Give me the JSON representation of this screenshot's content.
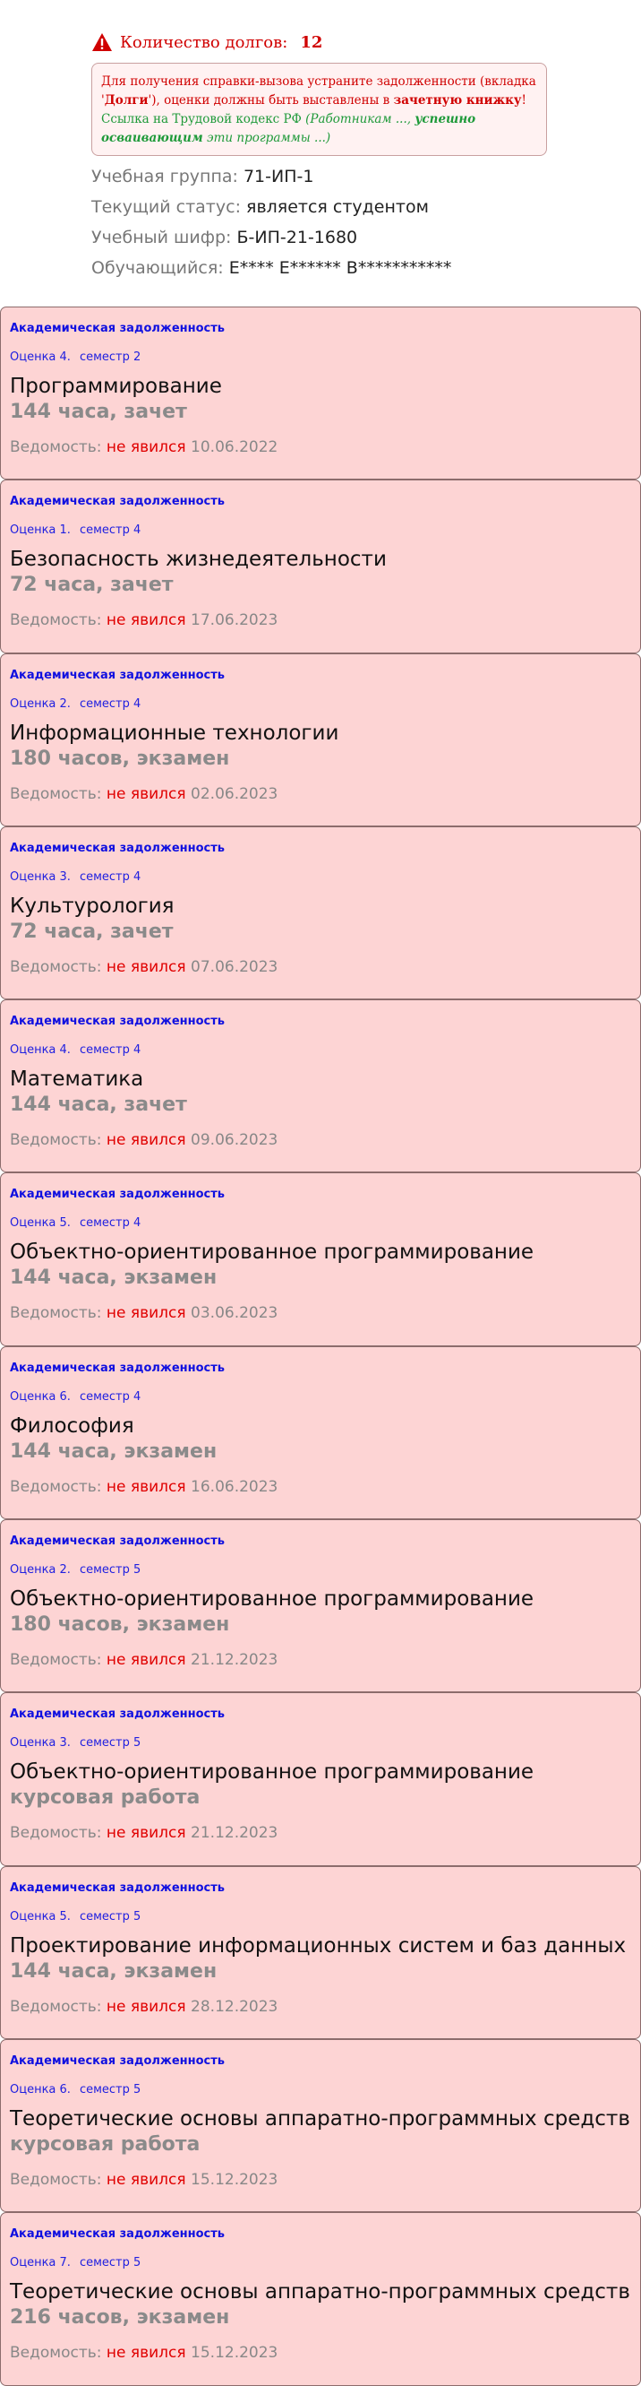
{
  "header": {
    "debt_label": "Количество долгов:",
    "debt_count": "12"
  },
  "notice": {
    "line1a": "Для получения справки-вызова устраните задолженности (вкладка '",
    "line1b": "Долги",
    "line1c": "'), оценки должны быть выставлены в ",
    "line1d": "зачетную книжку",
    "line1e": "!",
    "link_text": "Ссылка на Трудовой кодекс РФ",
    "link_paren_a": "(Работникам ..., ",
    "link_paren_b": "успешно осваивающим",
    "link_paren_c": " эти программы ...)"
  },
  "student": {
    "group_label": "Учебная группа:",
    "group_value": "71-ИП-1",
    "status_label": "Текущий статус:",
    "status_value": "является студентом",
    "cipher_label": "Учебный шифр:",
    "cipher_value": "Б-ИП-21-1680",
    "student_label": "Обучающийся:",
    "student_value": "Е**** Е****** В***********"
  },
  "debts": [
    {
      "kind": "Академическая задолженность",
      "grade": "Оценка 4.",
      "semester": "семестр 2",
      "title": "Программирование",
      "hours": "144 часа, зачет",
      "vedom_label": "Ведомость:",
      "status": "не явился",
      "date": "10.06.2022"
    },
    {
      "kind": "Академическая задолженность",
      "grade": "Оценка 1.",
      "semester": "семестр 4",
      "title": "Безопасность жизнедеятельности",
      "hours": "72 часа, зачет",
      "vedom_label": "Ведомость:",
      "status": "не явился",
      "date": "17.06.2023"
    },
    {
      "kind": "Академическая задолженность",
      "grade": "Оценка 2.",
      "semester": "семестр 4",
      "title": "Информационные технологии",
      "hours": "180 часов, экзамен",
      "vedom_label": "Ведомость:",
      "status": "не явился",
      "date": "02.06.2023"
    },
    {
      "kind": "Академическая задолженность",
      "grade": "Оценка 3.",
      "semester": "семестр 4",
      "title": "Культурология",
      "hours": "72 часа, зачет",
      "vedom_label": "Ведомость:",
      "status": "не явился",
      "date": "07.06.2023"
    },
    {
      "kind": "Академическая задолженность",
      "grade": "Оценка 4.",
      "semester": "семестр 4",
      "title": "Математика",
      "hours": "144 часа, зачет",
      "vedom_label": "Ведомость:",
      "status": "не явился",
      "date": "09.06.2023"
    },
    {
      "kind": "Академическая задолженность",
      "grade": "Оценка 5.",
      "semester": "семестр 4",
      "title": "Объектно-ориентированное программирование",
      "hours": "144 часа, экзамен",
      "vedom_label": "Ведомость:",
      "status": "не явился",
      "date": "03.06.2023"
    },
    {
      "kind": "Академическая задолженность",
      "grade": "Оценка 6.",
      "semester": "семестр 4",
      "title": "Философия",
      "hours": "144 часа, экзамен",
      "vedom_label": "Ведомость:",
      "status": "не явился",
      "date": "16.06.2023"
    },
    {
      "kind": "Академическая задолженность",
      "grade": "Оценка 2.",
      "semester": "семестр 5",
      "title": "Объектно-ориентированное программирование",
      "hours": "180 часов, экзамен",
      "vedom_label": "Ведомость:",
      "status": "не явился",
      "date": "21.12.2023"
    },
    {
      "kind": "Академическая задолженность",
      "grade": "Оценка 3.",
      "semester": "семестр 5",
      "title": "Объектно-ориентированное программирование",
      "hours": "курсовая работа",
      "vedom_label": "Ведомость:",
      "status": "не явился",
      "date": "21.12.2023"
    },
    {
      "kind": "Академическая задолженность",
      "grade": "Оценка 5.",
      "semester": "семестр 5",
      "title": "Проектирование информационных систем и баз данных",
      "hours": "144 часа, экзамен",
      "vedom_label": "Ведомость:",
      "status": "не явился",
      "date": "28.12.2023"
    },
    {
      "kind": "Академическая задолженность",
      "grade": "Оценка 6.",
      "semester": "семестр 5",
      "title": "Теоретические основы аппаратно-программных средств",
      "hours": "курсовая работа",
      "vedom_label": "Ведомость:",
      "status": "не явился",
      "date": "15.12.2023"
    },
    {
      "kind": "Академическая задолженность",
      "grade": "Оценка 7.",
      "semester": "семестр 5",
      "title": "Теоретические основы аппаратно-программных средств",
      "hours": "216 часов, экзамен",
      "vedom_label": "Ведомость:",
      "status": "не явился",
      "date": "15.12.2023"
    }
  ]
}
